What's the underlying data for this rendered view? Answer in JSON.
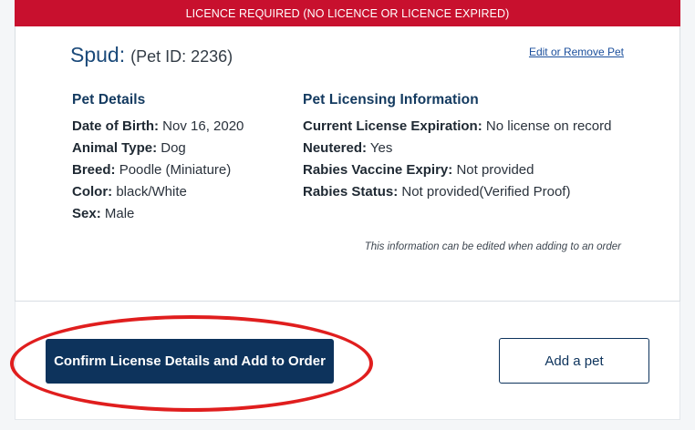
{
  "banner": {
    "text": "LICENCE REQUIRED (NO LICENCE OR LICENCE EXPIRED)"
  },
  "pet": {
    "name": "Spud:",
    "id_text": "(Pet ID: 2236)",
    "edit_link": "Edit or Remove Pet"
  },
  "pet_details": {
    "heading": "Pet Details",
    "fields": [
      {
        "label": "Date of Birth:",
        "value": "Nov 16, 2020"
      },
      {
        "label": "Animal Type:",
        "value": "Dog"
      },
      {
        "label": "Breed:",
        "value": "Poodle (Miniature)"
      },
      {
        "label": "Color:",
        "value": "black/White"
      },
      {
        "label": "Sex:",
        "value": "Male"
      }
    ]
  },
  "licensing": {
    "heading": "Pet Licensing Information",
    "fields": [
      {
        "label": "Current License Expiration:",
        "value": "No license on record"
      },
      {
        "label": "Neutered:",
        "value": "Yes"
      },
      {
        "label": "Rabies Vaccine Expiry:",
        "value": "Not provided"
      },
      {
        "label": "Rabies Status:",
        "value": "Not provided(Verified Proof)"
      }
    ]
  },
  "note": "This information can be edited when adding to an order",
  "actions": {
    "confirm_label": "Confirm License Details and Add to Order",
    "add_pet_label": "Add a pet"
  },
  "colors": {
    "banner_red": "#c8102e",
    "navy": "#0d335c",
    "annotation_red": "#e01e1e"
  }
}
